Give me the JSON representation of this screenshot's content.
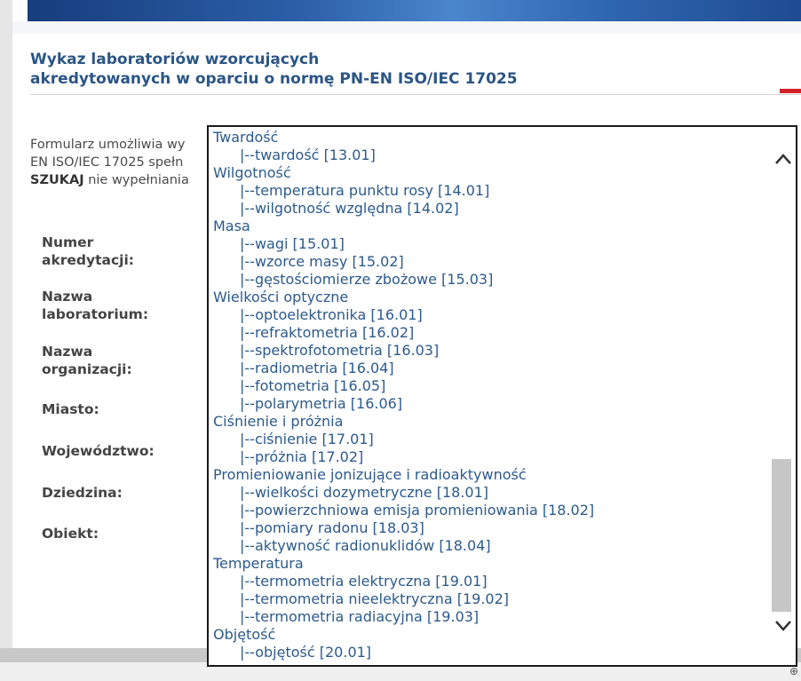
{
  "header": {
    "title_line1": "Wykaz laboratoriów wzorcujących",
    "title_line2": "akredytowanych w oparciu o normę PN-EN ISO/IEC 17025"
  },
  "intro": {
    "line1": "Formularz umożliwia wy",
    "line2": "EN ISO/IEC 17025 spełn",
    "line3_bold": "SZUKAJ",
    "line3_rest": " nie wypełniania"
  },
  "form": {
    "labels": [
      {
        "line1": "Numer",
        "line2": "akredytacji:"
      },
      {
        "line1": "Nazwa",
        "line2": "laboratorium:"
      },
      {
        "line1": "Nazwa",
        "line2": "organizacji:"
      },
      {
        "line1": "Miasto:",
        "line2": ""
      },
      {
        "line1": "Województwo:",
        "line2": ""
      },
      {
        "line1": "Dziedzina:",
        "line2": ""
      },
      {
        "line1": "Obiekt:",
        "line2": ""
      }
    ]
  },
  "dropdown": {
    "options": [
      {
        "text": "Twardość",
        "level": 0
      },
      {
        "text": "|--twardość [13.01]",
        "level": 1
      },
      {
        "text": "Wilgotność",
        "level": 0
      },
      {
        "text": "|--temperatura punktu rosy [14.01]",
        "level": 1
      },
      {
        "text": "|--wilgotność względna [14.02]",
        "level": 1
      },
      {
        "text": "Masa",
        "level": 0
      },
      {
        "text": "|--wagi [15.01]",
        "level": 1
      },
      {
        "text": "|--wzorce masy [15.02]",
        "level": 1
      },
      {
        "text": "|--gęstościomierze zbożowe [15.03]",
        "level": 1
      },
      {
        "text": "Wielkości optyczne",
        "level": 0
      },
      {
        "text": "|--optoelektronika [16.01]",
        "level": 1
      },
      {
        "text": "|--refraktometria [16.02]",
        "level": 1
      },
      {
        "text": "|--spektrofotometria [16.03]",
        "level": 1
      },
      {
        "text": "|--radiometria [16.04]",
        "level": 1
      },
      {
        "text": "|--fotometria [16.05]",
        "level": 1
      },
      {
        "text": "|--polarymetria [16.06]",
        "level": 1
      },
      {
        "text": "Ciśnienie i próżnia",
        "level": 0
      },
      {
        "text": "|--ciśnienie [17.01]",
        "level": 1
      },
      {
        "text": "|--próżnia [17.02]",
        "level": 1
      },
      {
        "text": "Promieniowanie jonizujące i radioaktywność",
        "level": 0
      },
      {
        "text": "|--wielkości dozymetryczne [18.01]",
        "level": 1
      },
      {
        "text": "|--powierzchniowa emisja promieniowania [18.02]",
        "level": 1
      },
      {
        "text": "|--pomiary radonu [18.03]",
        "level": 1
      },
      {
        "text": "|--aktywność radionuklidów [18.04]",
        "level": 1
      },
      {
        "text": "Temperatura",
        "level": 0
      },
      {
        "text": "|--termometria elektryczna [19.01]",
        "level": 1
      },
      {
        "text": "|--termometria nieelektryczna [19.02]",
        "level": 1
      },
      {
        "text": "|--termometria radiacyjna [19.03]",
        "level": 1
      },
      {
        "text": "Objętość",
        "level": 0
      },
      {
        "text": "|--objętość [20.01]",
        "level": 1
      }
    ],
    "scroll_up_icon": "chevron-up-icon",
    "scroll_down_icon": "chevron-down-icon"
  },
  "colors": {
    "title": "#2b5585",
    "option_text": "#2c5a8c",
    "accent_red": "#d3222a"
  }
}
